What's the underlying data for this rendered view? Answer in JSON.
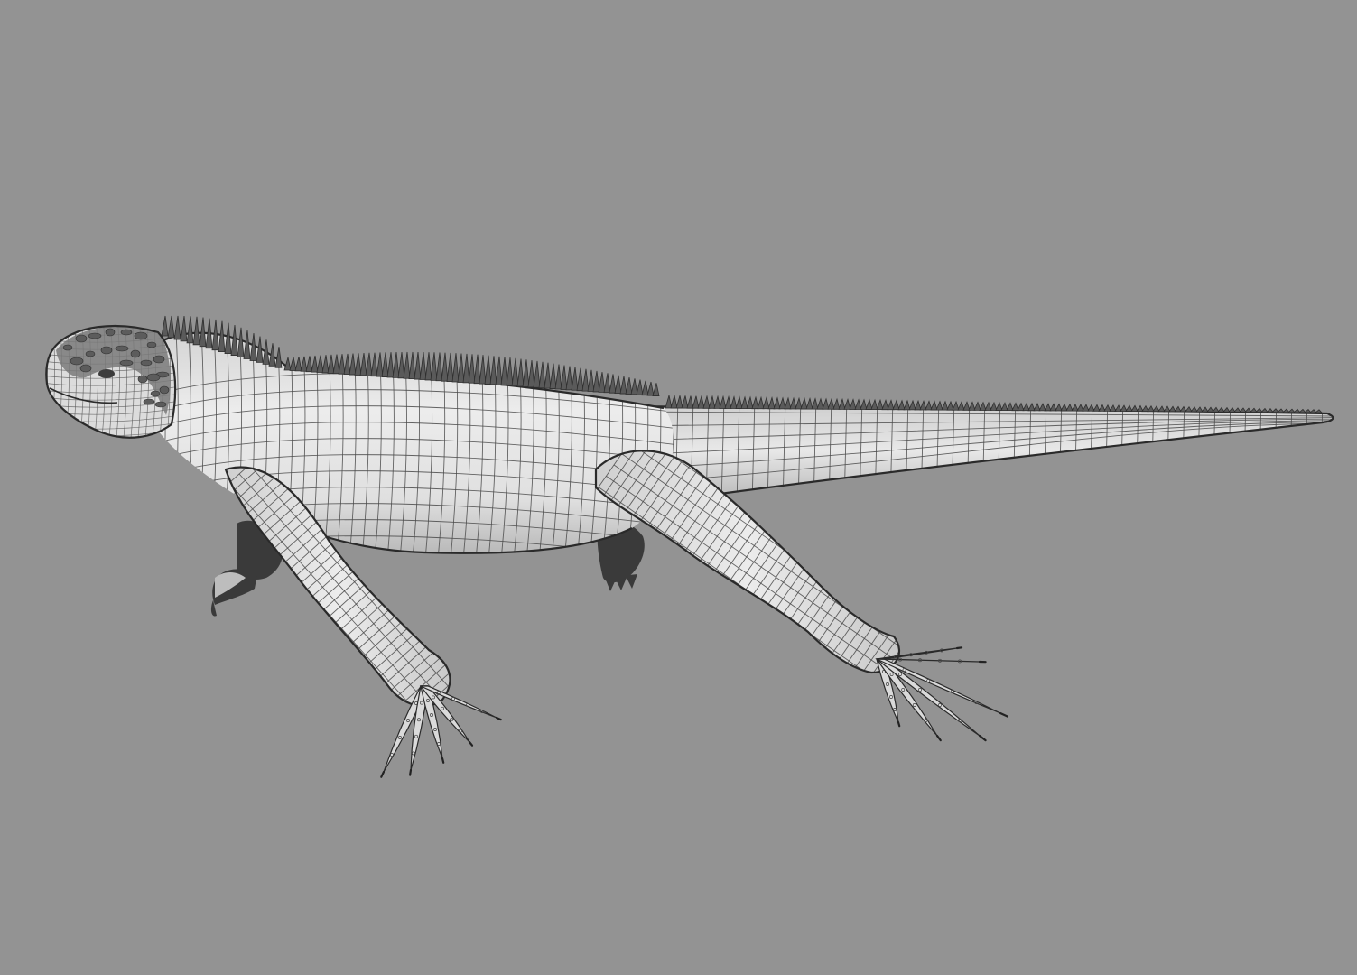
{
  "viewport": {
    "background": "#939393",
    "subject": "iguana-wireframe-model",
    "mesh_color": "#e2e2e2",
    "wire_color": "#4a4a4a"
  }
}
